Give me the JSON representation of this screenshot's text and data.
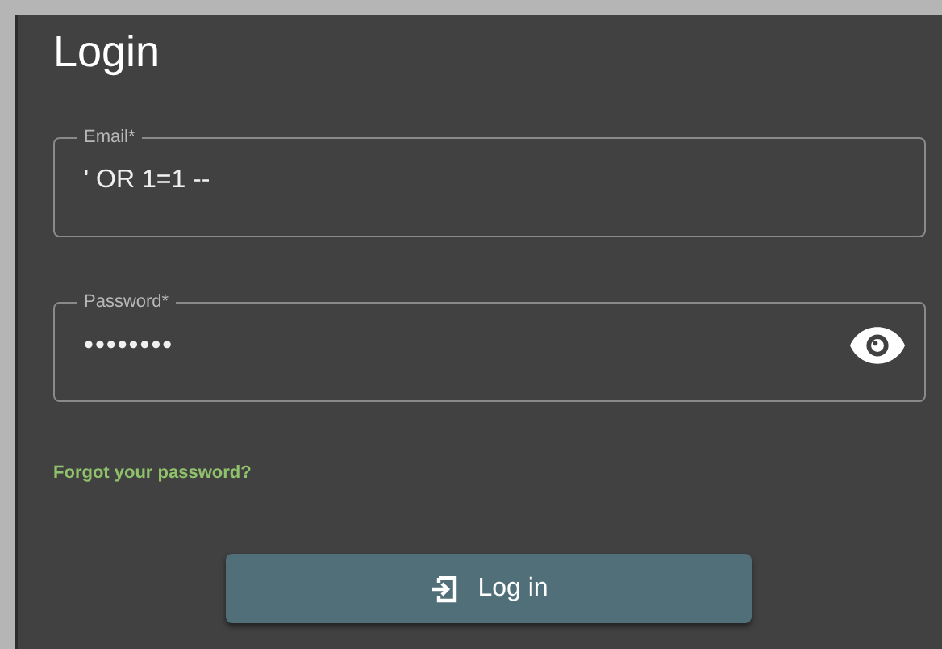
{
  "title": "Login",
  "fields": [
    {
      "label": "Email*",
      "value": "' OR 1=1 --",
      "kind": "text"
    },
    {
      "label": "Password*",
      "value": "••••••••",
      "kind": "password"
    }
  ],
  "forgot_link": "Forgot your password?",
  "login_button": "Log in"
}
